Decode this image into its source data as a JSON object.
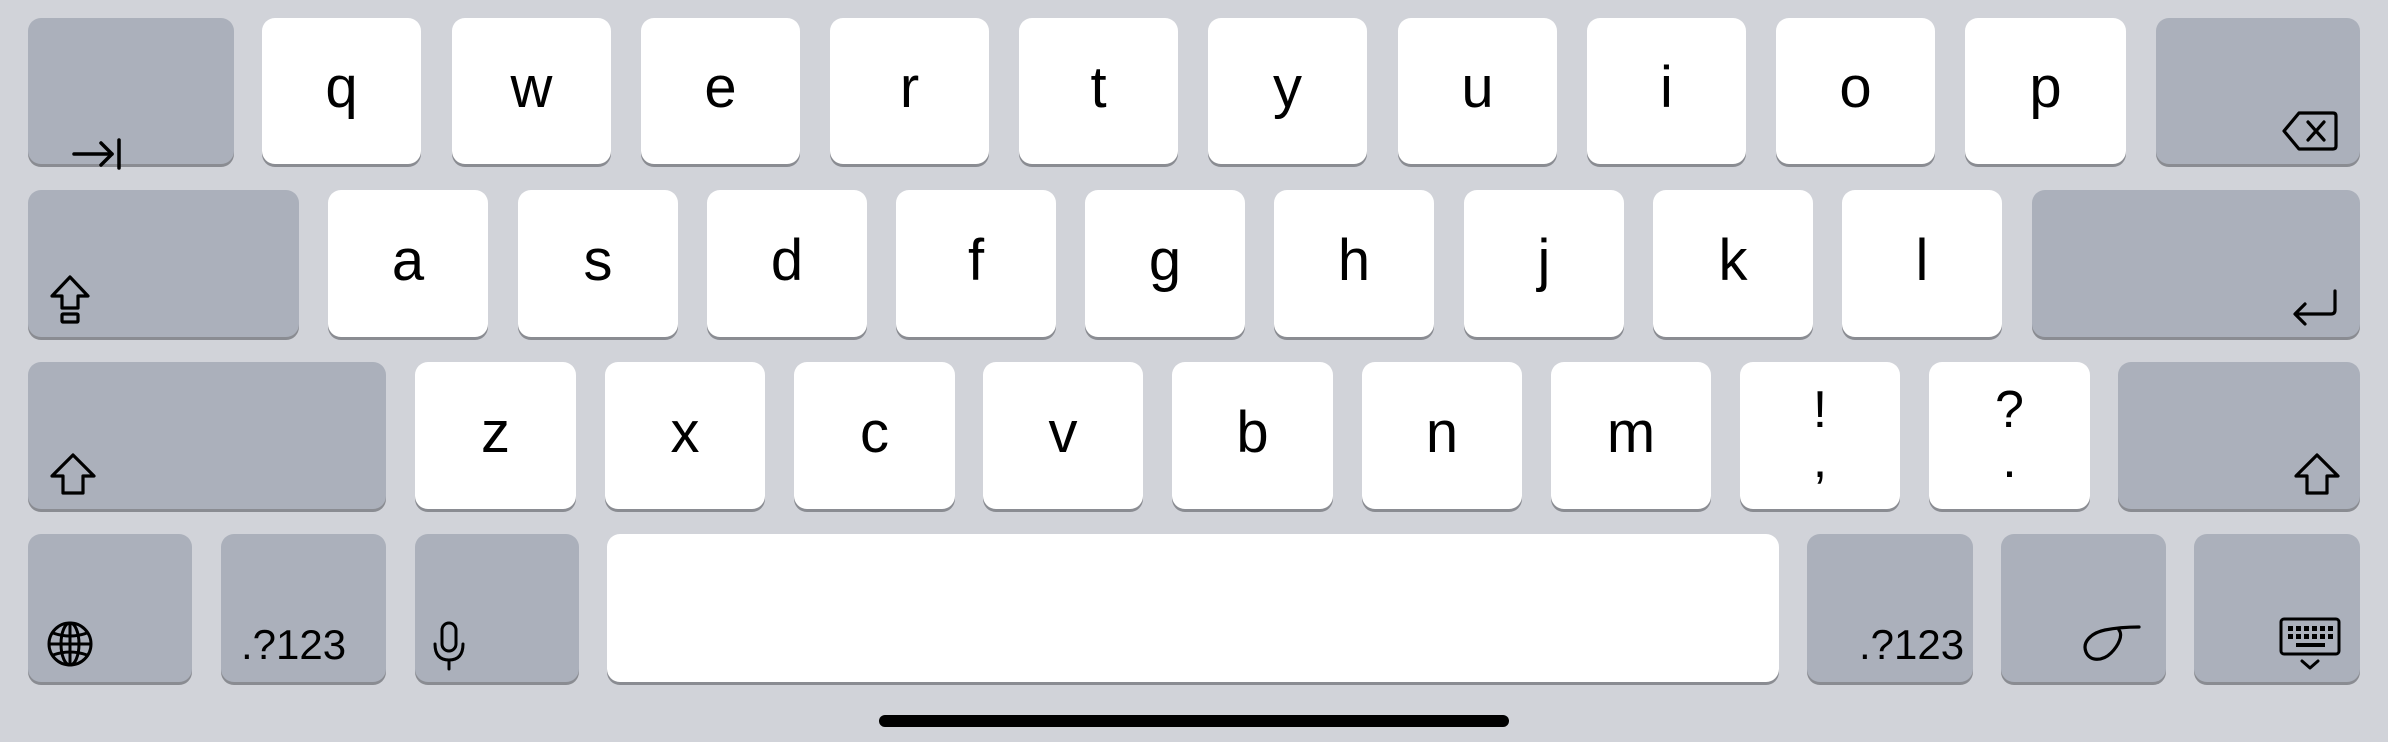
{
  "keyboard": {
    "row1": [
      "q",
      "w",
      "e",
      "r",
      "t",
      "y",
      "u",
      "i",
      "o",
      "p"
    ],
    "row2": [
      "a",
      "s",
      "d",
      "f",
      "g",
      "h",
      "j",
      "k",
      "l"
    ],
    "row3": [
      "z",
      "x",
      "c",
      "v",
      "b",
      "n",
      "m"
    ],
    "punct_key_1": {
      "top": "!",
      "bottom": ","
    },
    "punct_key_2": {
      "top": "?",
      "bottom": "."
    },
    "numbers_key_left": ".?123",
    "numbers_key_right": ".?123",
    "icons": {
      "tab": "tab-icon",
      "delete": "delete-icon",
      "caps_lock": "caps-lock-icon",
      "return": "return-icon",
      "shift": "shift-icon",
      "globe": "globe-icon",
      "dictation": "microphone-icon",
      "handwriting": "scribble-icon",
      "dismiss": "keyboard-dismiss-icon"
    },
    "colors": {
      "background": "#d1d3d9",
      "letter_key": "#ffffff",
      "function_key": "#abb0bb",
      "key_shadow": "#8a8c92"
    }
  }
}
